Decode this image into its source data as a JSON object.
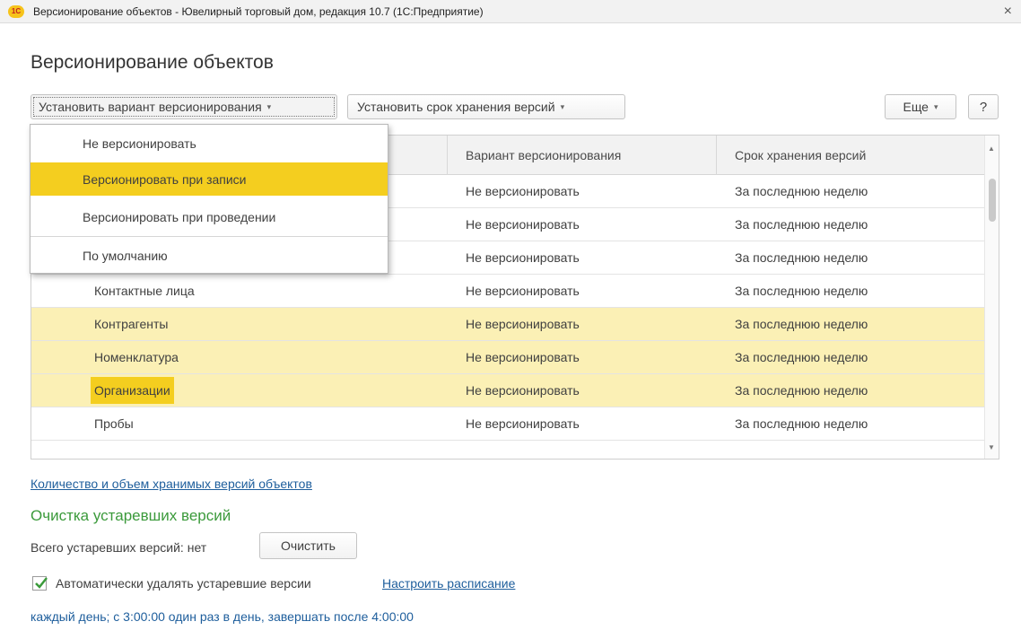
{
  "window": {
    "logo_text": "1С",
    "title": "Версионирование объектов - Ювелирный торговый дом, редакция 10.7 (1С:Предприятие)",
    "close": "×"
  },
  "page_title": "Версионирование объектов",
  "toolbar": {
    "set_variant_label": "Установить вариант версионирования",
    "set_term_label": "Установить срок хранения версий",
    "more_label": "Еще",
    "help_label": "?",
    "caret": "▾"
  },
  "dropdown": {
    "items": [
      "Не версионировать",
      "Версионировать при записи",
      "Версионировать при проведении",
      "По умолчанию"
    ],
    "highlighted_index": 1
  },
  "table": {
    "columns": [
      "",
      "Вариант версионирования",
      "Срок хранения версий"
    ],
    "rows": [
      {
        "name": "",
        "variant": "Не версионировать",
        "term": "За последнюю неделю",
        "selected": false
      },
      {
        "name": "",
        "variant": "Не версионировать",
        "term": "За последнюю неделю",
        "selected": false
      },
      {
        "name": "",
        "variant": "Не версионировать",
        "term": "За последнюю неделю",
        "selected": false
      },
      {
        "name": "Контактные лица",
        "variant": "Не версионировать",
        "term": "За последнюю неделю",
        "selected": false
      },
      {
        "name": "Контрагенты",
        "variant": "Не версионировать",
        "term": "За последнюю неделю",
        "selected": true
      },
      {
        "name": "Номенклатура",
        "variant": "Не версионировать",
        "term": "За последнюю неделю",
        "selected": true
      },
      {
        "name": "Организации",
        "variant": "Не версионировать",
        "term": "За последнюю неделю",
        "selected": true,
        "current": true
      },
      {
        "name": "Пробы",
        "variant": "Не версионировать",
        "term": "За последнюю неделю",
        "selected": false
      }
    ]
  },
  "bottom": {
    "versions_link": "Количество и объем хранимых версий объектов",
    "cleanup_title": "Очистка устаревших версий",
    "obsolete_total": "Всего устаревших версий: нет",
    "clear_button": "Очистить",
    "auto_delete_label": "Автоматически удалять устаревшие версии",
    "auto_delete_checked": true,
    "schedule_link": "Настроить расписание",
    "schedule_text": "каждый день; с 3:00:00 один раз в день, завершать после 4:00:00"
  },
  "colors": {
    "accent_yellow": "#f4ce1f",
    "selected_row": "#fbf0b5",
    "link_blue": "#1e5e9c",
    "section_green": "#3b9a3b"
  }
}
